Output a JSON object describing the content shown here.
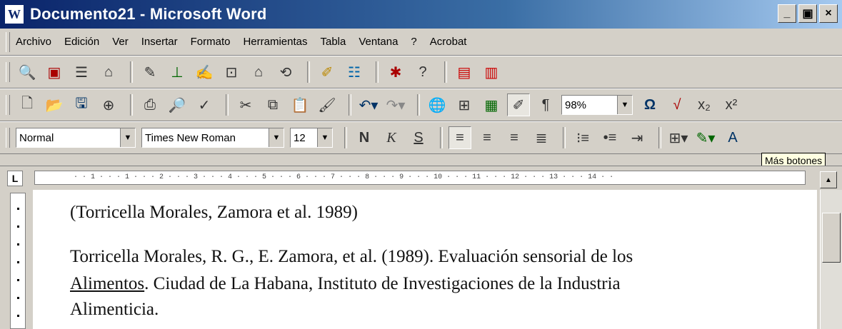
{
  "window": {
    "title": "Documento21 - Microsoft Word",
    "app_icon": "word-icon",
    "controls": [
      "_",
      "▣",
      "×"
    ]
  },
  "menu": [
    "Archivo",
    "Edición",
    "Ver",
    "Insertar",
    "Formato",
    "Herramientas",
    "Tabla",
    "Ventana",
    "?",
    "Acrobat"
  ],
  "toolbar_std": {
    "zoom": "98%",
    "paragraph_mark": "¶",
    "omega": "Ω"
  },
  "formatting": {
    "style": "Normal",
    "font": "Times New Roman",
    "size": "12",
    "bold": "N",
    "italic": "K",
    "underline": "S",
    "text_color_glyph": "A"
  },
  "tooltip": "Más botones",
  "ruler": {
    "corner": "L",
    "ticks": "· · 1 · · · 1 · · · 2 · · · 3 · · · 4 · · · 5 · · · 6 · · · 7 · · · 8 · · · 9 · · · 10 · · · 11 · · · 12 · · · 13 · · · 14 · ·"
  },
  "document": {
    "line1": "(Torricella Morales, Zamora et al. 1989)",
    "line2": "Torricella Morales, R. G., E. Zamora, et al. (1989). Evaluación sensorial de los",
    "line3_a": "Alimentos",
    "line3_b": ". Ciudad de La Habana, Instituto de Investigaciones de la Industria",
    "line4": "Alimenticia."
  }
}
